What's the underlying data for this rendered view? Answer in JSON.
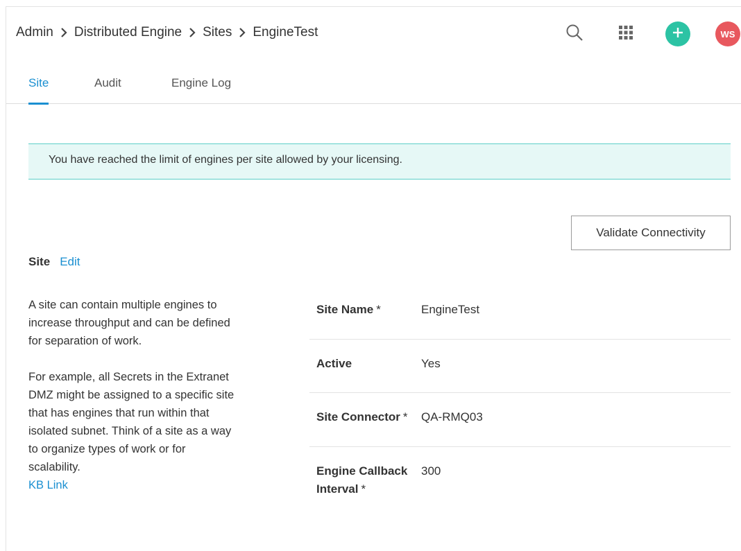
{
  "colors": {
    "accent": "#1a8fd1",
    "link": "#1a8fd1",
    "add_button": "#2cc3a4",
    "avatar": "#e8585e",
    "alert_bg": "#e6f8f6",
    "alert_border": "#5ccfc7"
  },
  "breadcrumb": {
    "items": [
      "Admin",
      "Distributed Engine",
      "Sites",
      "EngineTest"
    ]
  },
  "header": {
    "icons": [
      "search-icon",
      "apps-grid-icon",
      "plus-icon"
    ],
    "avatar_initials": "WS"
  },
  "tabs": [
    {
      "label": "Site",
      "active": true
    },
    {
      "label": "Audit",
      "active": false
    },
    {
      "label": "Engine Log",
      "active": false
    }
  ],
  "alert": {
    "message": "You have reached the limit of engines per site allowed by your licensing."
  },
  "actions": {
    "validate_label": "Validate Connectivity"
  },
  "section": {
    "title": "Site",
    "edit_label": "Edit",
    "description_1": "A site can contain multiple engines to increase throughput and can be defined for separation of work.",
    "description_2": "For example, all Secrets in the Extranet DMZ might be assigned to a specific site that has engines that run within that isolated subnet. Think of a site as a way to organize types of work or for scalability.",
    "kb_link": "KB Link"
  },
  "fields": [
    {
      "label": "Site Name",
      "required_mark": "*",
      "value": "EngineTest"
    },
    {
      "label": "Active",
      "required_mark": "",
      "value": "Yes"
    },
    {
      "label": "Site Connector",
      "required_mark": "*",
      "value": "QA-RMQ03"
    },
    {
      "label": "Engine Callback Interval",
      "required_mark": "*",
      "value": "300"
    }
  ]
}
